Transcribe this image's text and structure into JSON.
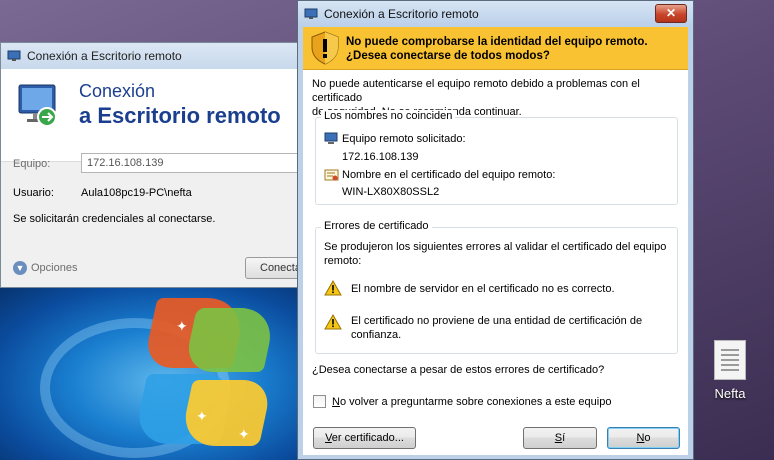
{
  "background_window": {
    "title": "Conexión a Escritorio remoto",
    "header_line1": "Conexión",
    "header_line2": "a Escritorio remoto",
    "equipo_label": "Equipo:",
    "equipo_value": "172.16.108.139",
    "usuario_label": "Usuario:",
    "usuario_value": "Aula108pc19-PC\\nefta",
    "credentials_note": "Se solicitarán credenciales al conectarse.",
    "options_label": "Opciones",
    "connect_label": "Conecta"
  },
  "dialog": {
    "title": "Conexión a Escritorio remoto",
    "close_glyph": "✕",
    "banner_line1": "No puede comprobarse la identidad del equipo remoto.",
    "banner_line2": "¿Desea conectarse de todos modos?",
    "intro_line1": "No puede autenticarse el equipo remoto debido a problemas con el certificado",
    "intro_line2": "de seguridad. No se recomienda continuar.",
    "names_group": {
      "label": "Los nombres no coinciden",
      "requested_label": "Equipo remoto solicitado:",
      "requested_value": "172.16.108.139",
      "cert_name_label": "Nombre en el certificado del equipo remoto:",
      "cert_name_value": "WIN-LX80X80SSL2"
    },
    "errors_group": {
      "label": "Errores de certificado",
      "intro_line1": "Se produjeron los siguientes errores al validar el certificado del equipo",
      "intro_line2": "remoto:",
      "error1": "El nombre de servidor en el certificado no es correcto.",
      "error2_line1": "El certificado no proviene de una entidad de certificación de",
      "error2_line2": "confianza."
    },
    "question": "¿Desea conectarse a pesar de estos errores de certificado?",
    "checkbox_label_first": "N",
    "checkbox_label_rest": "o volver a preguntarme sobre conexiones a este equipo",
    "checkbox_checked": false,
    "view_cert_first": "V",
    "view_cert_rest": "er certificado...",
    "yes_first": "S",
    "yes_rest": "í",
    "no_first": "N",
    "no_rest": "o"
  },
  "desktop": {
    "icon_label": "Nefta"
  },
  "colors": {
    "banner": "#f9c233",
    "title_text_blue": "#1b3f8f",
    "close_button": "#c8452a"
  }
}
